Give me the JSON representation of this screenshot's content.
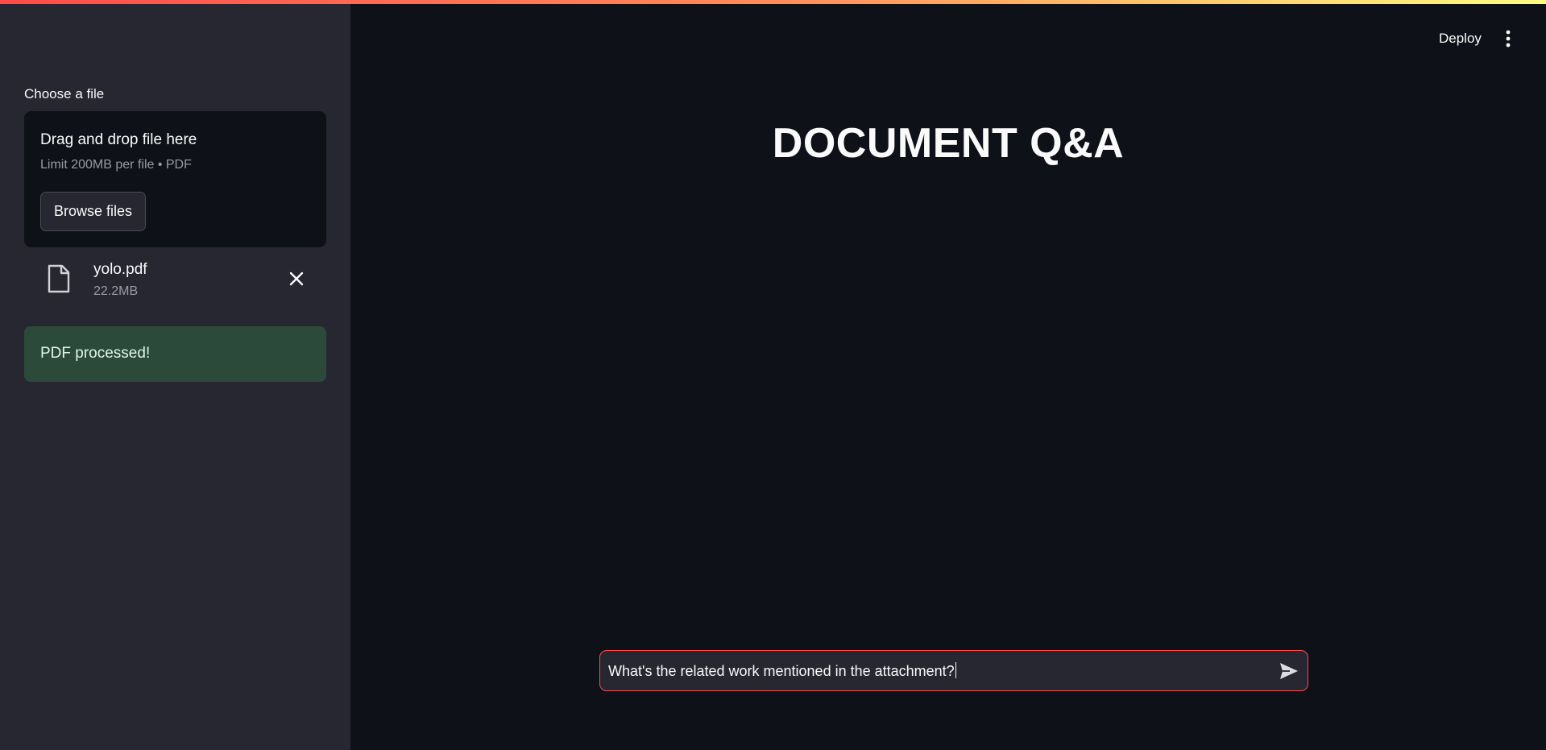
{
  "app": {
    "accent_color": "#ff4b4b",
    "background_color": "#0e1117",
    "sidebar_color": "#262730"
  },
  "header": {
    "deploy_label": "Deploy",
    "menu_icon": "vertical-dots-icon"
  },
  "sidebar": {
    "uploader": {
      "label": "Choose a file",
      "drop_title": "Drag and drop file here",
      "limit_text": "Limit 200MB per file • PDF",
      "browse_label": "Browse files"
    },
    "uploaded_file": {
      "name": "yolo.pdf",
      "size": "22.2MB",
      "icon": "file-icon",
      "remove_icon": "close-icon"
    },
    "status": {
      "message": "PDF processed!",
      "color": "#2b4a3a"
    }
  },
  "main": {
    "title": "DOCUMENT Q&A",
    "chat": {
      "value": "What's the related work mentioned in the attachment?",
      "send_icon": "send-icon"
    }
  }
}
